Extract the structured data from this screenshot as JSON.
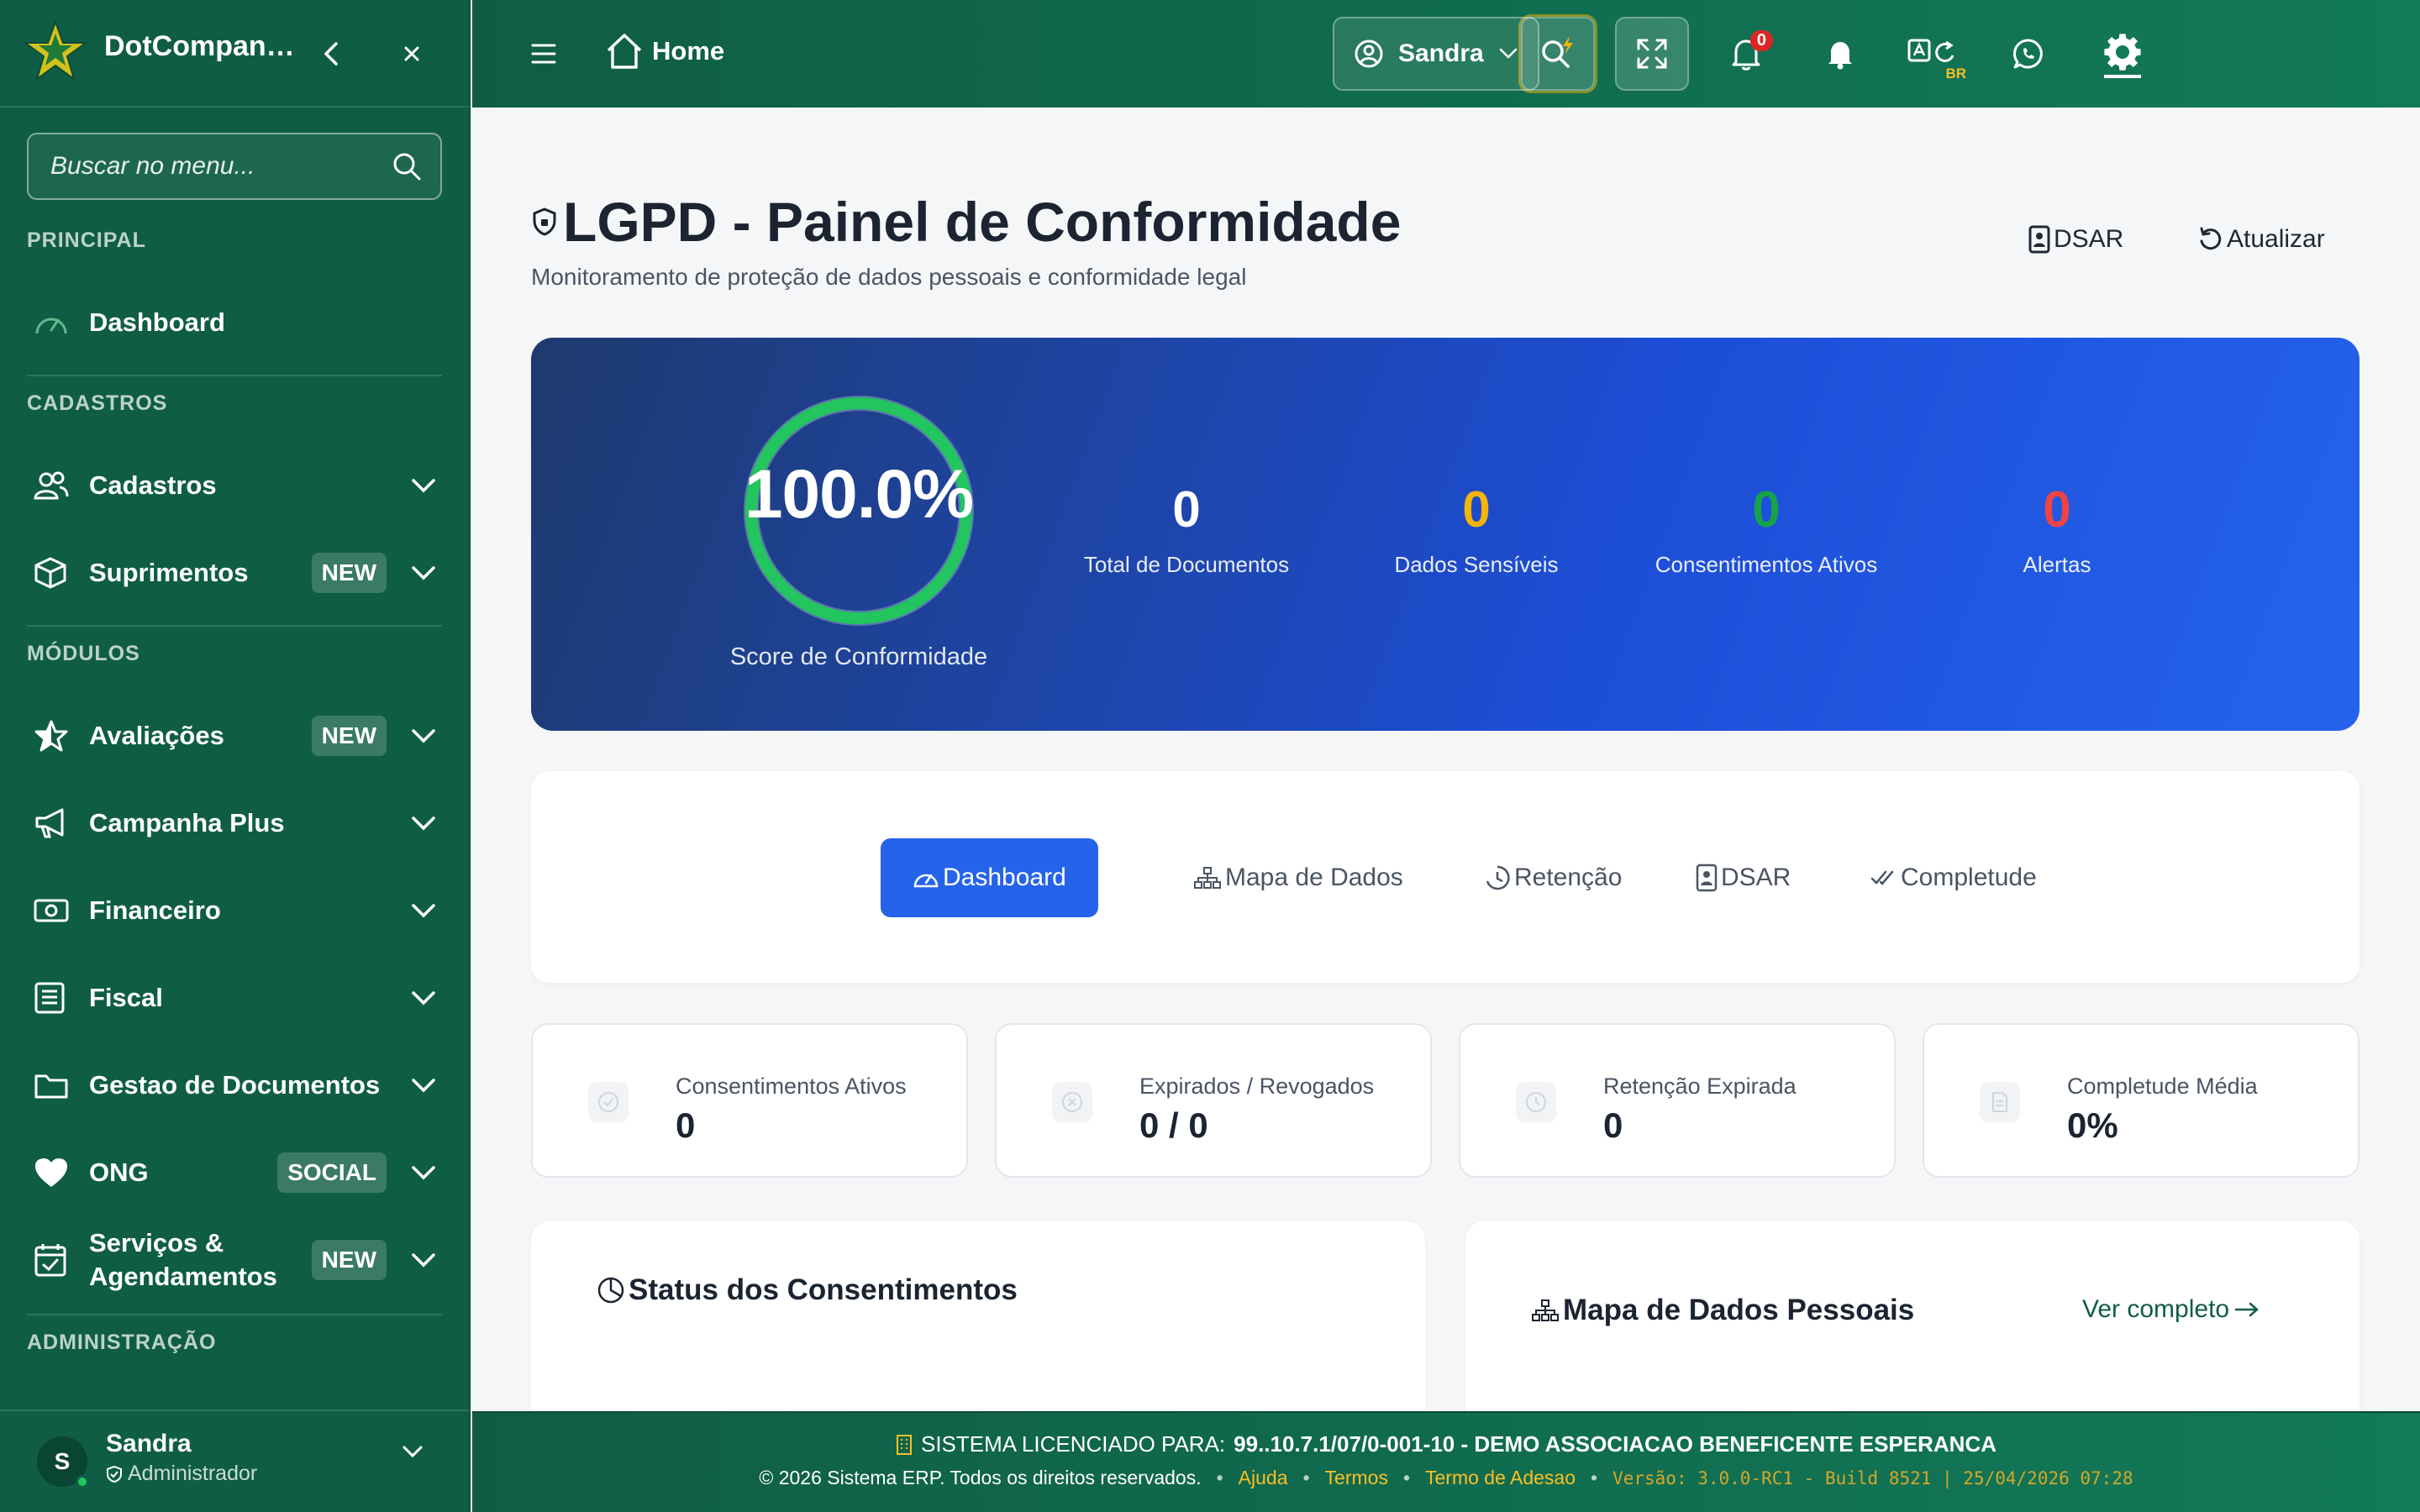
{
  "sidebar": {
    "brand": "DotCompanion",
    "search_placeholder": "Buscar no menu...",
    "sections": {
      "principal": "PRINCIPAL",
      "cadastros": "CADASTROS",
      "modulos": "MÓDULOS",
      "administracao": "ADMINISTRAÇÃO"
    },
    "items": {
      "dashboard": "Dashboard",
      "cadastros": "Cadastros",
      "suprimentos": "Suprimentos",
      "suprimentos_badge": "NEW",
      "avaliacoes": "Avaliações",
      "avaliacoes_badge": "NEW",
      "campanha": "Campanha Plus",
      "financeiro": "Financeiro",
      "fiscal": "Fiscal",
      "documentos": "Gestao de Documentos",
      "ong": "ONG",
      "ong_badge": "SOCIAL",
      "servicos_l1": "Serviços &",
      "servicos_l2": "Agendamentos",
      "servicos_badge": "NEW"
    },
    "user": {
      "initial": "S",
      "name": "Sandra",
      "role": "Administrador"
    }
  },
  "topbar": {
    "home": "Home",
    "notifications_count": "0",
    "language_code": "BR",
    "user_name": "Sandra"
  },
  "page": {
    "title": "LGPD - Painel de Conformidade",
    "subtitle": "Monitoramento de proteção de dados pessoais e conformidade legal",
    "dsar_button": "DSAR",
    "refresh_button": "Atualizar"
  },
  "hero": {
    "score": "100.0%",
    "score_fraction": 1.0,
    "score_label": "Score de Conformidade",
    "stats": [
      {
        "value": "0",
        "label": "Total de Documentos",
        "color": "#ffffff"
      },
      {
        "value": "0",
        "label": "Dados Sensíveis",
        "color": "#f5b40a"
      },
      {
        "value": "0",
        "label": "Consentimentos Ativos",
        "color": "#16a34a"
      },
      {
        "value": "0",
        "label": "Alertas",
        "color": "#ef4444"
      }
    ]
  },
  "tabs": [
    {
      "label": "Dashboard"
    },
    {
      "label": "Mapa de Dados"
    },
    {
      "label": "Retenção"
    },
    {
      "label": "DSAR"
    },
    {
      "label": "Completude"
    }
  ],
  "kpis": [
    {
      "label": "Consentimentos Ativos",
      "value": "0",
      "icon": "check-shield-icon"
    },
    {
      "label": "Expirados / Revogados",
      "value": "0 / 0",
      "icon": "x-circle-icon"
    },
    {
      "label": "Retenção Expirada",
      "value": "0",
      "icon": "clock-icon"
    },
    {
      "label": "Completude Média",
      "value": "0%",
      "icon": "document-icon"
    }
  ],
  "panels": {
    "consent_title": "Status dos Consentimentos",
    "map_title": "Mapa de Dados Pessoais",
    "map_link": "Ver completo"
  },
  "footer": {
    "license_prefix": "SISTEMA LICENCIADO PARA:",
    "license_value": "99..10.7.1/07/0-001-10 - DEMO ASSOCIACAO BENEFICENTE ESPERANCA",
    "copyright": "© 2026 Sistema ERP. Todos os direitos reservados.",
    "help": "Ajuda",
    "terms": "Termos",
    "adhesion": "Termo de Adesao",
    "version": "Versão: 3.0.0-RC1 - Build 8521 | 25/04/2026 07:28"
  },
  "colors": {
    "sidebar_bg": "#0f5d45",
    "accent_blue": "#2563eb",
    "ring_green": "#22c55e"
  }
}
